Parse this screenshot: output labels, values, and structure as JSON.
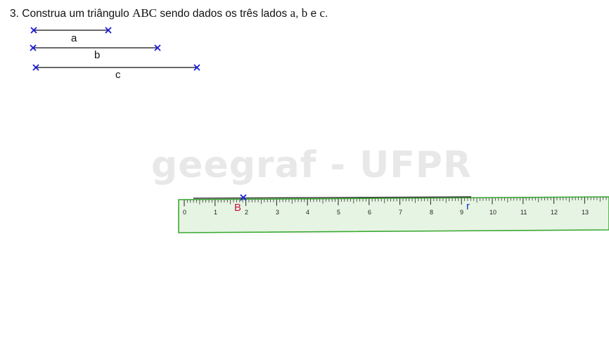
{
  "problem": {
    "number": "3.",
    "text_before": "Construa um triângulo ",
    "triangle": "ABC",
    "text_middle": " sendo dados os três lados ",
    "side_a": "a",
    "sep1": ", ",
    "side_b": "b",
    "sep2": " e ",
    "side_c": "c",
    "text_end": "."
  },
  "segments": [
    {
      "label": "a",
      "length_units": 2.4
    },
    {
      "label": "b",
      "length_units": 4.0
    },
    {
      "label": "c",
      "length_units": 5.2
    }
  ],
  "watermark": "geegraf - UFPR",
  "ruler": {
    "numbers": [
      "0",
      "1",
      "2",
      "3",
      "4",
      "5",
      "6",
      "7",
      "8",
      "9",
      "10",
      "11",
      "12",
      "13"
    ],
    "fill_color": "#e6f4e3",
    "border_color": "#3aa832"
  },
  "point_b": {
    "label": "B",
    "color": "#cc1144"
  },
  "line_r": {
    "label": "r",
    "color": "#1133cc"
  },
  "marker_color": "#1a1adb"
}
